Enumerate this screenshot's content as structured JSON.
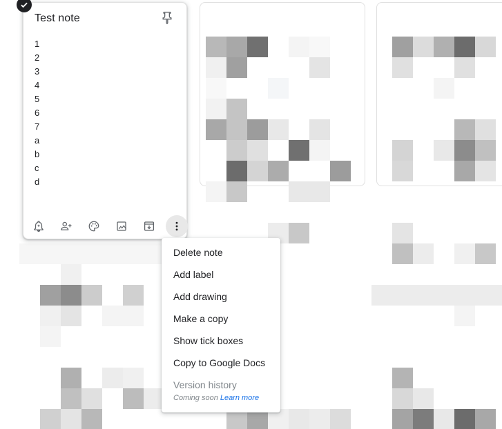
{
  "note": {
    "title": "Test note",
    "lines": [
      "1",
      "2",
      "3",
      "4",
      "5",
      "6",
      "7",
      "a",
      "b",
      "c",
      "d"
    ],
    "selected": true
  },
  "toolbar": {
    "icons": [
      "remind-me-icon",
      "collaborator-icon",
      "background-options-icon",
      "add-image-icon",
      "archive-icon",
      "more-vert-icon"
    ]
  },
  "menu": {
    "items": [
      "Delete note",
      "Add label",
      "Add drawing",
      "Make a copy",
      "Show tick boxes",
      "Copy to Google Docs"
    ],
    "version_history": {
      "label": "Version history",
      "status": "Coming soon",
      "link": "Learn more"
    }
  },
  "colors": {
    "accent_link": "#1a73e8",
    "text_primary": "#202124",
    "text_disabled": "#80868b",
    "icon": "#5f6368"
  }
}
